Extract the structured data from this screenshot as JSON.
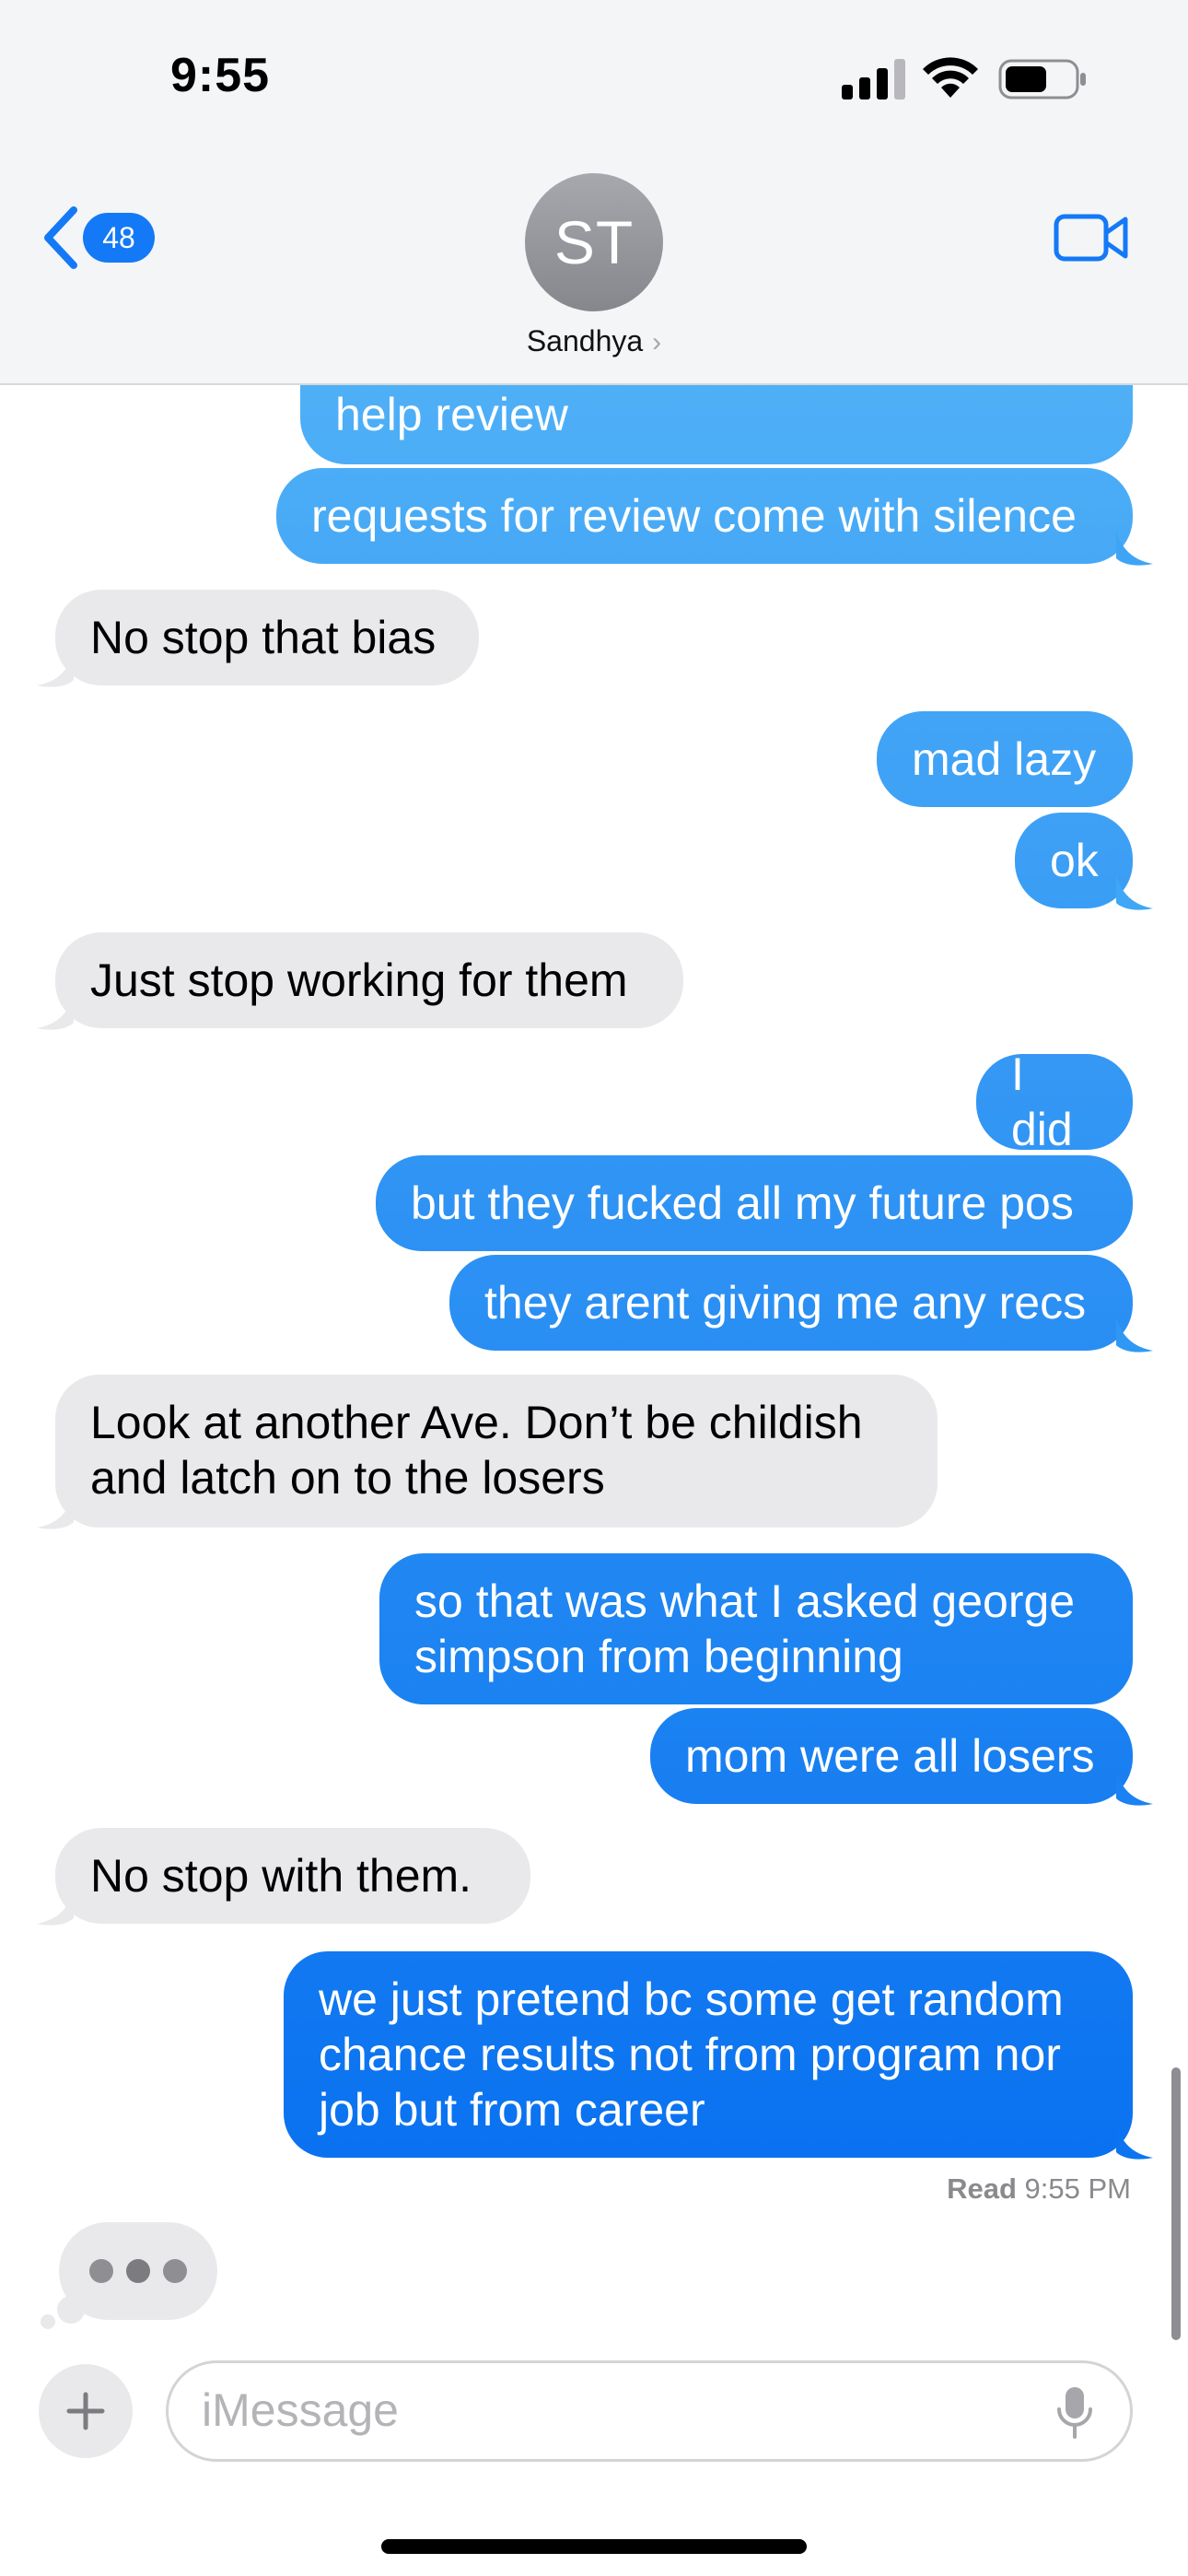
{
  "status_bar": {
    "time": "9:55"
  },
  "header": {
    "back_count": "48",
    "avatar_initials": "ST",
    "contact_name": "Sandhya",
    "contact_chevron": "›"
  },
  "messages": [
    {
      "from": "me",
      "text": "help review"
    },
    {
      "from": "me",
      "text": "requests for review come with silence"
    },
    {
      "from": "them",
      "text": "No stop that bias"
    },
    {
      "from": "me",
      "text": "mad lazy"
    },
    {
      "from": "me",
      "text": "ok"
    },
    {
      "from": "them",
      "text": "Just stop working for them"
    },
    {
      "from": "me",
      "text": "I did"
    },
    {
      "from": "me",
      "text": "but they fucked all my future pos"
    },
    {
      "from": "me",
      "text": "they arent giving me any recs"
    },
    {
      "from": "them",
      "text": "Look at another Ave.  Don’t be childish\nand latch on to the losers"
    },
    {
      "from": "me",
      "text": "so that was what I asked george\nsimpson from beginning"
    },
    {
      "from": "me",
      "text": "mom were all losers"
    },
    {
      "from": "them",
      "text": "No stop with them."
    },
    {
      "from": "me",
      "text": "we just pretend bc some get random\nchance results not from program nor\njob but from career"
    }
  ],
  "read_receipt": {
    "label": "Read",
    "time": "9:55 PM"
  },
  "input": {
    "placeholder": "iMessage"
  },
  "colors": {
    "sent_top": "#4fb0f7",
    "sent_bottom": "#0a72f0",
    "received": "#e9e9eb",
    "accent": "#1479f6"
  },
  "icons": [
    "back-chevron-icon",
    "video-camera-icon",
    "plus-icon",
    "microphone-icon",
    "signal-icon",
    "wifi-icon",
    "battery-icon"
  ]
}
